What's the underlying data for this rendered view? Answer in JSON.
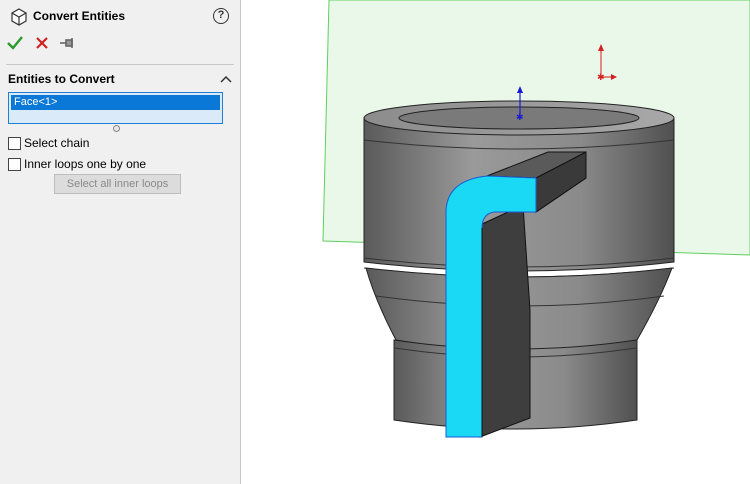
{
  "feature": {
    "title": "Convert Entities",
    "help_icon": "?",
    "icons": {
      "feature_icon": "cube-icon",
      "help": "help-icon"
    }
  },
  "actions": {
    "ok": "check-icon",
    "cancel": "close-icon",
    "pin": "pushpin-icon",
    "colors": {
      "ok": "#2a9a2a",
      "cancel": "#d42020"
    }
  },
  "section": {
    "title": "Entities to Convert",
    "entities": [
      "Face<1>"
    ],
    "select_chain_label": "Select chain",
    "select_chain_checked": false,
    "inner_loops_label": "Inner loops one by one",
    "inner_loops_checked": false,
    "select_all_inner_loops_label": "Select all inner loops",
    "select_all_inner_loops_enabled": false
  },
  "viewport": {
    "highlight_color": "#19d9f5",
    "body_color": "#7b7b7b",
    "sketch_plane_border": "#5fcf5f"
  }
}
